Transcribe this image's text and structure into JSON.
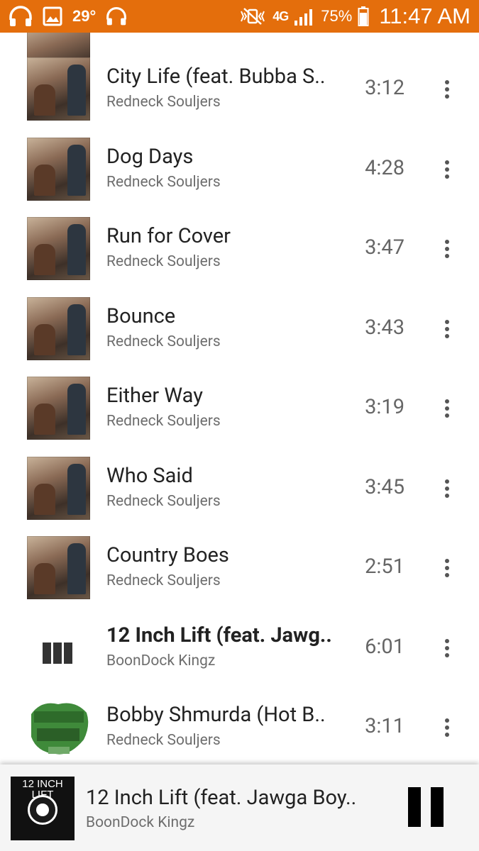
{
  "status_bar": {
    "temperature": "29°",
    "network": "4G",
    "battery": "75%",
    "time": "11:47 AM",
    "background_color": "#e46e0c",
    "left_icons": [
      "headphones-icon",
      "image-icon",
      "headphones-icon"
    ],
    "right_icons": [
      "mute-vibrate-icon",
      "network-4g-icon",
      "signal-icon",
      "battery-icon"
    ]
  },
  "tracks": [
    {
      "title": "City Life (feat. Bubba S..",
      "artist": "Redneck Souljers",
      "duration": "3:12",
      "art": "redneck-souljers-album-art",
      "playing": false
    },
    {
      "title": "Dog Days",
      "artist": "Redneck Souljers",
      "duration": "4:28",
      "art": "redneck-souljers-album-art",
      "playing": false
    },
    {
      "title": "Run for Cover",
      "artist": "Redneck Souljers",
      "duration": "3:47",
      "art": "redneck-souljers-album-art",
      "playing": false
    },
    {
      "title": "Bounce",
      "artist": "Redneck Souljers",
      "duration": "3:43",
      "art": "redneck-souljers-album-art",
      "playing": false
    },
    {
      "title": "Either Way",
      "artist": "Redneck Souljers",
      "duration": "3:19",
      "art": "redneck-souljers-album-art",
      "playing": false
    },
    {
      "title": "Who Said",
      "artist": "Redneck Souljers",
      "duration": "3:45",
      "art": "redneck-souljers-album-art",
      "playing": false
    },
    {
      "title": "Country Boes",
      "artist": "Redneck Souljers",
      "duration": "2:51",
      "art": "redneck-souljers-album-art",
      "playing": false
    },
    {
      "title": "12 Inch Lift (feat. Jawg..",
      "artist": "BoonDock Kingz",
      "duration": "6:01",
      "art": "now-playing-equalizer-icon",
      "playing": true
    },
    {
      "title": "Bobby Shmurda (Hot B..",
      "artist": "Redneck Souljers",
      "duration": "3:11",
      "art": "tiller-gang-album-art",
      "playing": false
    }
  ],
  "now_playing": {
    "title": "12 Inch Lift (feat. Jawga Boy..",
    "artist": "BoonDock Kingz",
    "cover_title": "12 INCH LIFT",
    "play_state_icon": "pause-icon"
  },
  "colors": {
    "title_text": "#222222",
    "secondary_text": "#6e6e6e",
    "accent_status": "#e46e0c"
  }
}
